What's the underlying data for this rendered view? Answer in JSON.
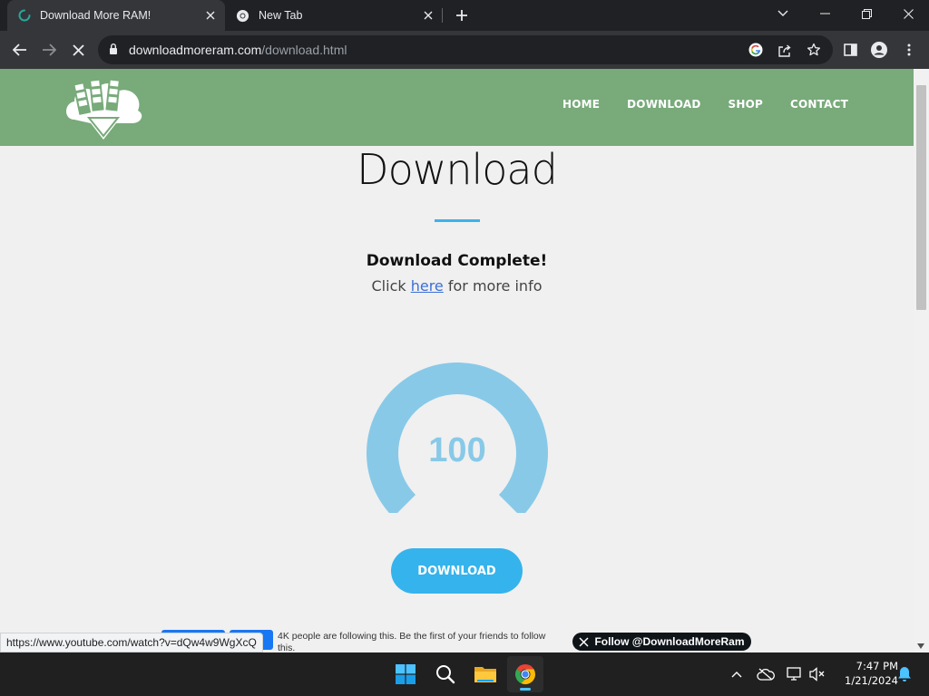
{
  "browser": {
    "tabs": [
      {
        "title": "Download More RAM!",
        "active": true
      },
      {
        "title": "New Tab",
        "active": false
      }
    ],
    "address": {
      "domain": "downloadmoreram.com",
      "path": "/download.html"
    }
  },
  "site": {
    "nav": [
      "HOME",
      "DOWNLOAD",
      "SHOP",
      "CONTACT"
    ],
    "page_title": "Download",
    "status_heading": "Download Complete!",
    "info": {
      "prefix": "Click ",
      "link": "here",
      "suffix": " for more info"
    },
    "gauge": {
      "value": "100",
      "percent": 100,
      "color": "#88c9e8"
    },
    "download_button": "DOWNLOAD",
    "social": {
      "facebook_text": "4K people are following this. Be the first of your friends to follow this.",
      "twitter_button": "Follow @DownloadMoreRam"
    },
    "colors": {
      "header": "#78aa7a",
      "accent": "#35b3ec"
    }
  },
  "status_bar": {
    "url": "https://www.youtube.com/watch?v=dQw4w9WgXcQ"
  },
  "taskbar": {
    "apps": [
      "start-icon",
      "search-icon",
      "file-explorer-icon",
      "chrome-icon"
    ],
    "time": "7:47 PM",
    "date": "1/21/2024"
  }
}
